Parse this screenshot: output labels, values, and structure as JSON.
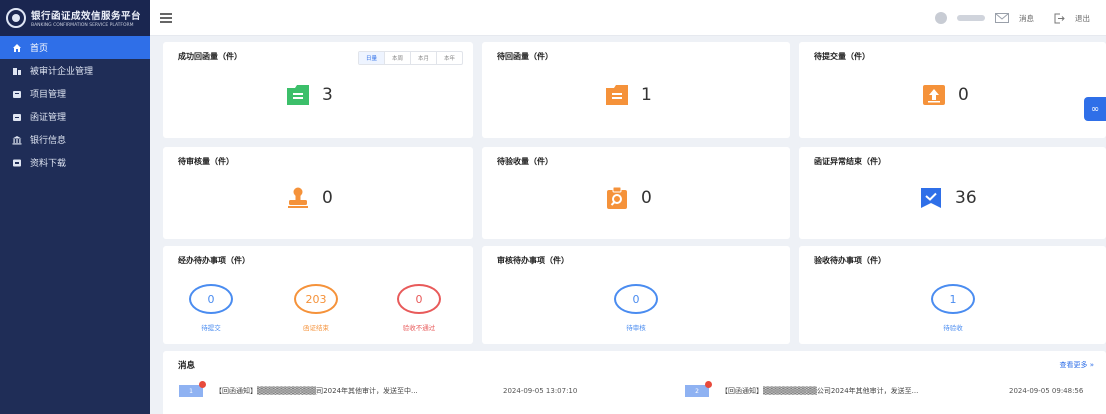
{
  "sidebar": {
    "brand_title": "银行函证成效信服务平台",
    "brand_sub": "BANKING CONFIRMATION SERVICE PLATFORM",
    "items": [
      {
        "label": "首页",
        "icon": "home-icon",
        "active": true
      },
      {
        "label": "被审计企业管理",
        "icon": "building-icon",
        "active": false
      },
      {
        "label": "项目管理",
        "icon": "folder-icon",
        "active": false
      },
      {
        "label": "函证管理",
        "icon": "letter-icon",
        "active": false
      },
      {
        "label": "银行信息",
        "icon": "bank-icon",
        "active": false
      },
      {
        "label": "资料下载",
        "icon": "download-icon",
        "active": false
      }
    ]
  },
  "header": {
    "messages_label": "消息",
    "logout_label": "退出"
  },
  "cards": {
    "returned": {
      "title": "成功回函量（件）",
      "value": "3",
      "periods": [
        "日量",
        "本周",
        "本月",
        "本年"
      ],
      "icon": "folder-icon",
      "color": "#3cbf6a"
    },
    "pending_return": {
      "title": "待回函量（件）",
      "value": "1",
      "icon": "folder-icon",
      "color": "#f5923a"
    },
    "pending_submit": {
      "title": "待提交量（件）",
      "value": "0",
      "icon": "upload-icon",
      "color": "#f5923a"
    },
    "pending_review": {
      "title": "待审核量（件）",
      "value": "0",
      "icon": "stamp-icon",
      "color": "#f5923a"
    },
    "pending_accept": {
      "title": "待验收量（件）",
      "value": "0",
      "icon": "clipboard-search-icon",
      "color": "#f5923a"
    },
    "abnormal": {
      "title": "函证异常结束（件）",
      "value": "36",
      "icon": "check-flag-icon",
      "color": "#2f6fe8"
    }
  },
  "todo": {
    "handling": {
      "title": "经办待办事项（件）",
      "rings": [
        {
          "value": "0",
          "label": "待提交",
          "color": "#4a8cf0"
        },
        {
          "value": "203",
          "label": "函证结束",
          "color": "#f5923a"
        },
        {
          "value": "0",
          "label": "验收不通过",
          "color": "#e85a5a"
        }
      ]
    },
    "review": {
      "title": "审核待办事项（件）",
      "rings": [
        {
          "value": "0",
          "label": "待审核",
          "color": "#4a8cf0"
        }
      ]
    },
    "accept": {
      "title": "验收待办事项（件）",
      "rings": [
        {
          "value": "1",
          "label": "待验收",
          "color": "#4a8cf0"
        }
      ]
    }
  },
  "messages": {
    "title": "消息",
    "more": "查看更多 »",
    "items": [
      {
        "num": "1",
        "text": "【回函通知】▒▒▒▒▒▒▒▒▒▒▒司2024年其他审计，发送至中...",
        "time": "2024-09-05 13:07:10"
      },
      {
        "num": "2",
        "text": "【回函通知】▒▒▒▒▒▒▒▒▒▒公司2024年其他审计，发送至...",
        "time": "2024-09-05 09:48:56"
      }
    ]
  }
}
